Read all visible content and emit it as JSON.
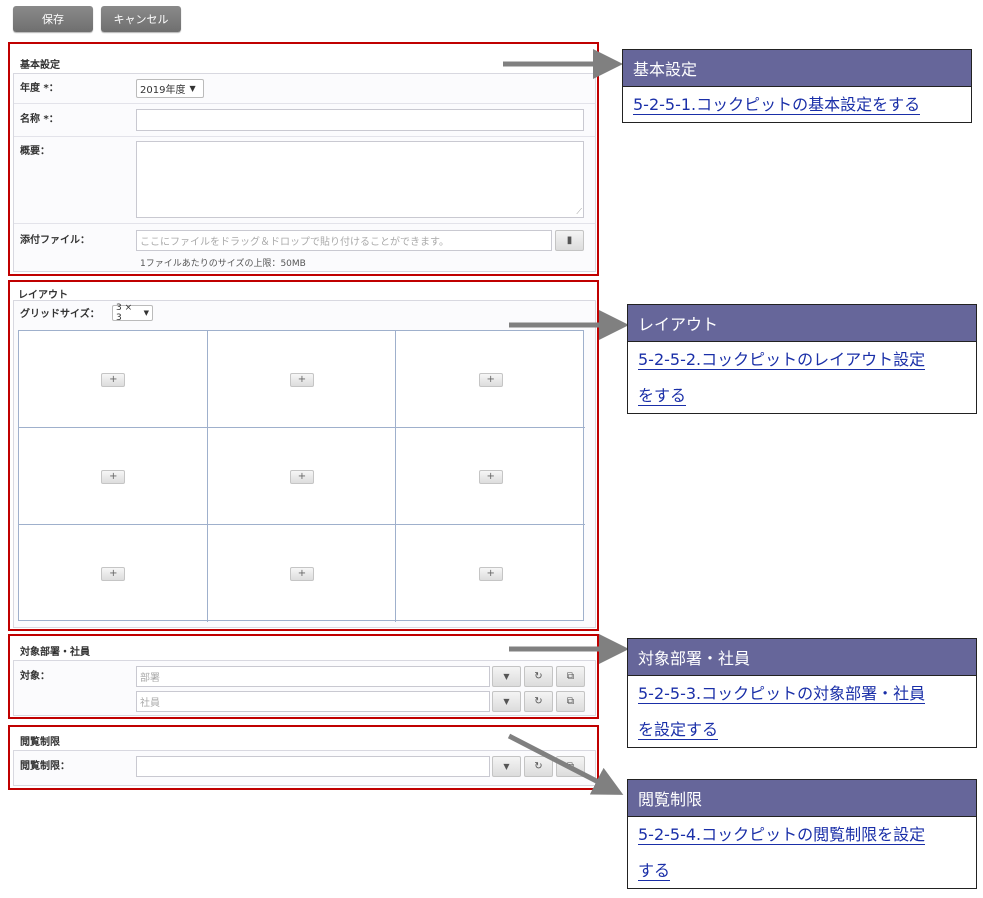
{
  "toolbar": {
    "save_label": "保存",
    "cancel_label": "キャンセル"
  },
  "basic": {
    "title": "基本設定",
    "year_label": "年度 *：",
    "year_value": "2019年度",
    "name_label": "名称 *：",
    "summary_label": "概要：",
    "attach_label": "添付ファイル：",
    "attach_placeholder": "ここにファイルをドラッグ＆ドロップで貼り付けることができます。",
    "attach_hint": "1ファイルあたりのサイズの上限：50MB"
  },
  "layout": {
    "title": "レイアウト",
    "grid_label": "グリッドサイズ：",
    "grid_value": "3 × 3",
    "cell_add": "+"
  },
  "target": {
    "title": "対象部署・社員",
    "label": "対象：",
    "dept_placeholder": "部署",
    "emp_placeholder": "社員"
  },
  "access": {
    "title": "閲覧制限",
    "label": "閲覧制限："
  },
  "callouts": [
    {
      "head": "基本設定",
      "link_lines": [
        "5-2-5-1.コックピットの基本設定をする"
      ]
    },
    {
      "head": "レイアウト",
      "link_lines": [
        "5-2-5-2.コックピットのレイアウト設定",
        "をする"
      ]
    },
    {
      "head": "対象部署・社員",
      "link_lines": [
        "5-2-5-3.コックピットの対象部署・社員",
        "を設定する"
      ]
    },
    {
      "head": "閲覧制限",
      "link_lines": [
        "5-2-5-4.コックピットの閲覧制限を設定",
        "する"
      ]
    }
  ],
  "colors": {
    "highlight": "#c00000",
    "callout_head": "#66669a",
    "link": "#1a2fa8",
    "arrow": "#808080"
  },
  "icons": {
    "dropdown": "chevron-down-icon",
    "reset": "refresh-icon",
    "pick": "copy-icon",
    "attach": "attach-icon"
  }
}
